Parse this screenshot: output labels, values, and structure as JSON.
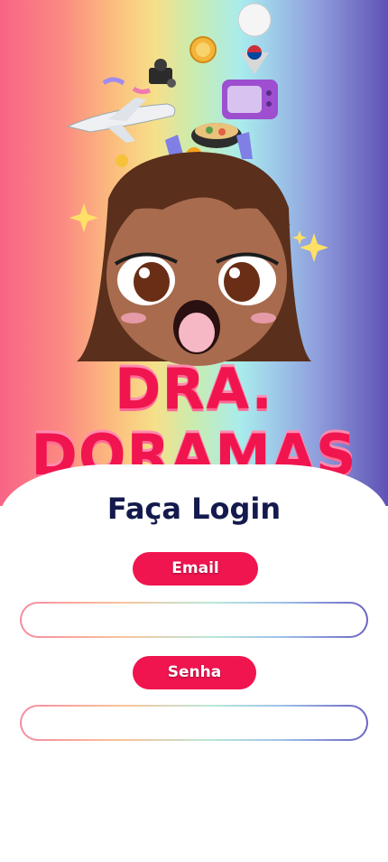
{
  "hero": {
    "logo_text": "DRA. DORAMAS"
  },
  "login": {
    "title": "Faça Login",
    "email_label": "Email",
    "email_value": "",
    "password_label": "Senha",
    "password_value": ""
  },
  "colors": {
    "accent": "#f0154f",
    "title": "#141a4d"
  }
}
